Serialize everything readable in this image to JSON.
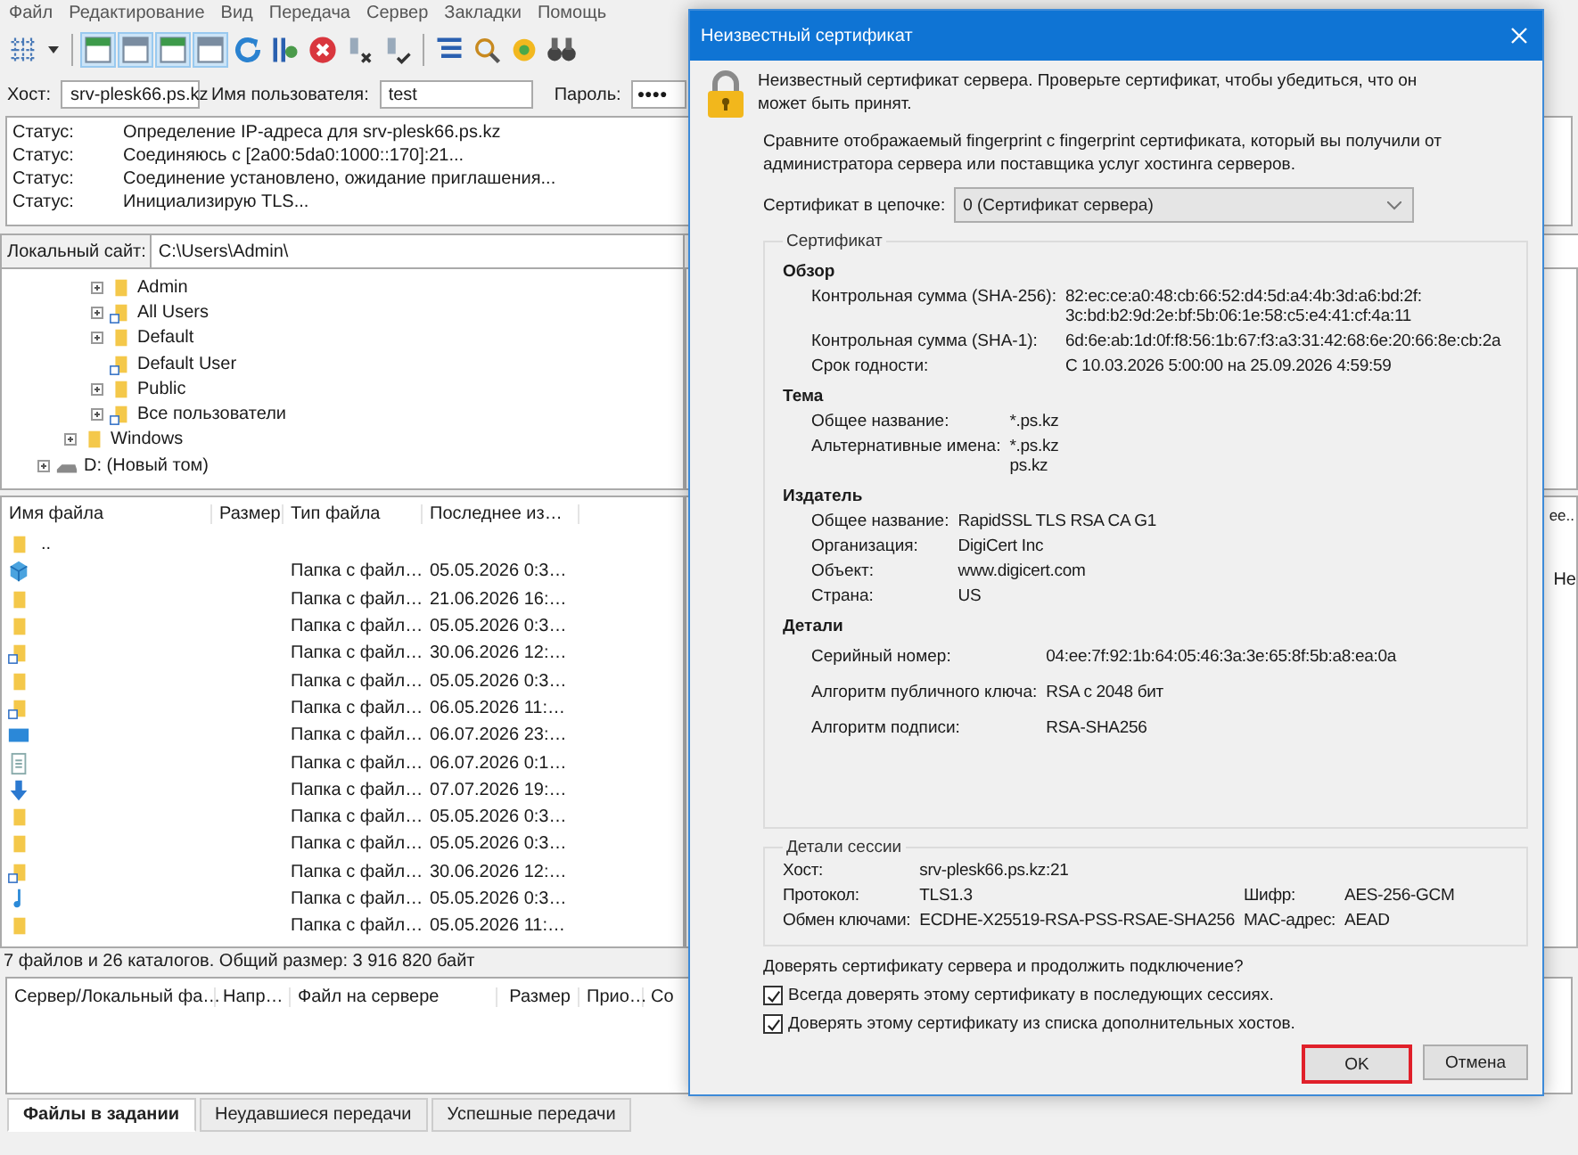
{
  "menu": [
    "Файл",
    "Редактирование",
    "Вид",
    "Передача",
    "Сервер",
    "Закладки",
    "Помощь"
  ],
  "toolbar": {
    "toggles": [
      {
        "pressed": true
      },
      {
        "pressed": true
      },
      {
        "pressed": true
      },
      {
        "pressed": true
      }
    ]
  },
  "quickconnect": {
    "host_label": "Хост:",
    "host": "srv-plesk66.ps.kz",
    "user_label": "Имя пользователя:",
    "user": "test",
    "password_label": "Пароль:",
    "password": "●●●●"
  },
  "log": [
    {
      "label": "Статус:",
      "message": "Определение IP-адреса для srv-plesk66.ps.kz"
    },
    {
      "label": "Статус:",
      "message": "Соединяюсь с [2a00:5da0:1000::170]:21..."
    },
    {
      "label": "Статус:",
      "message": "Соединение установлено, ожидание приглашения..."
    },
    {
      "label": "Статус:",
      "message": "Инициализирую TLS..."
    }
  ],
  "local_site": {
    "label": "Локальный сайт:",
    "path": "C:\\Users\\Admin\\"
  },
  "tree": [
    {
      "children": [
        {
          "children": [
            {
              "label": "Admin",
              "expandable": true
            },
            {
              "label": "All Users",
              "expandable": true
            },
            {
              "label": "Default",
              "expandable": true
            },
            {
              "label": "Default User",
              "expandable": false
            },
            {
              "label": "Public",
              "expandable": true
            },
            {
              "label": "Все пользователи",
              "expandable": true
            }
          ]
        },
        {
          "label": "Windows",
          "expandable": true
        }
      ]
    },
    {
      "label": "D: (Новый том)",
      "expandable": true
    }
  ],
  "file_list": {
    "columns": [
      "Имя файла",
      "Размер",
      "Тип файла",
      "Последнее из…"
    ],
    "rows": [
      {
        "name": ".."
      },
      {
        "type": "Папка с файл…",
        "modified": "05.05.2026 0:3…"
      },
      {
        "type": "Папка с файл…",
        "modified": "21.06.2026 16:…"
      },
      {
        "type": "Папка с файл…",
        "modified": "05.05.2026 0:3…"
      },
      {
        "type": "Папка с файл…",
        "modified": "30.06.2026 12:…"
      },
      {
        "type": "Папка с файл…",
        "modified": "05.05.2026 0:3…"
      },
      {
        "type": "Папка с файл…",
        "modified": "06.05.2026 11:…"
      },
      {
        "type": "Папка с файл…",
        "modified": "06.07.2026 23:…"
      },
      {
        "type": "Папка с файл…",
        "modified": "06.07.2026 0:1…"
      },
      {
        "type": "Папка с файл…",
        "modified": "07.07.2026 19:…"
      },
      {
        "type": "Папка с файл…",
        "modified": "05.05.2026 0:3…"
      },
      {
        "type": "Папка с файл…",
        "modified": "05.05.2026 0:3…"
      },
      {
        "type": "Папка с файл…",
        "modified": "30.06.2026 12:…"
      },
      {
        "type": "Папка с файл…",
        "modified": "05.05.2026 0:3…"
      },
      {
        "type": "Папка с файл…",
        "modified": "05.05.2026 11:…"
      }
    ]
  },
  "file_summary": "7 файлов и 26 каталогов. Общий размер: 3 916 820 байт",
  "remote_pane": {
    "column_header": "ее..",
    "message": "Не"
  },
  "queue": {
    "columns": [
      "Сервер/Локальный фа…",
      "Напр…",
      "Файл на сервере",
      "Размер",
      "Прио…",
      "Со"
    ]
  },
  "queue_tabs": [
    {
      "label": "Файлы в задании",
      "selected": true
    },
    {
      "label": "Неудавшиеся передачи",
      "selected": false
    },
    {
      "label": "Успешные передачи",
      "selected": false
    }
  ],
  "dialog": {
    "title": "Неизвестный сертификат",
    "intro": "Неизвестный сертификат сервера. Проверьте сертификат, чтобы убедиться, что он может быть принят.",
    "compare": "Сравните отображаемый fingerprint с fingerprint сертификата, который вы получили от администратора сервера или поставщика услуг хостинга серверов.",
    "chain_label": "Сертификат в цепочке:",
    "chain_value": "0 (Сертификат сервера)",
    "certificate_title": "Сертификат",
    "sections": [
      {
        "title": "Обзор",
        "rows": [
          {
            "label": "Контрольная сумма (SHA-256):",
            "values": [
              "82:ec:ce:a0:48:cb:66:52:d4:5d:a4:4b:3d:a6:bd:2f:",
              "3c:bd:b2:9d:2e:bf:5b:06:1e:58:c5:e4:41:cf:4a:11"
            ]
          },
          {
            "label": "Контрольная сумма (SHA-1):",
            "values": [
              "6d:6e:ab:1d:0f:f8:56:1b:67:f3:a3:31:42:68:6e:20:66:8e:cb:2a"
            ]
          },
          {
            "label": "Срок годности:",
            "values": [
              "С 10.03.2026 5:00:00 на 25.09.2026 4:59:59"
            ]
          }
        ]
      },
      {
        "title": "Тема",
        "rows": [
          {
            "label": "Общее название:",
            "values": [
              "*.ps.kz"
            ]
          },
          {
            "label": "Альтернативные имена:",
            "values": [
              "*.ps.kz",
              "ps.kz"
            ]
          }
        ]
      },
      {
        "title": "Издатель",
        "rows": [
          {
            "label": "Общее название:",
            "values": [
              "RapidSSL TLS RSA CA G1"
            ]
          },
          {
            "label": "Организация:",
            "values": [
              "DigiCert Inc"
            ]
          },
          {
            "label": "Объект:",
            "values": [
              "www.digicert.com"
            ]
          },
          {
            "label": "Страна:",
            "values": [
              "US"
            ]
          }
        ]
      },
      {
        "title": "Детали",
        "rows": [
          {
            "label": "Серийный номер:",
            "values": [
              "04:ee:7f:92:1b:64:05:46:3a:3e:65:8f:5b:a8:ea:0a"
            ]
          },
          {
            "label": "Алгоритм публичного ключа:",
            "values": [
              "RSA с 2048 бит"
            ]
          },
          {
            "label": "Алгоритм подписи:",
            "values": [
              "RSA-SHA256"
            ]
          }
        ]
      }
    ],
    "session_title": "Детали сессии",
    "session": [
      {
        "label": "Хост:",
        "value": "srv-plesk66.ps.kz:21"
      },
      {
        "label": "Протокол:",
        "value": "TLS1.3",
        "label2": "Шифр:",
        "value2": "AES-256-GCM"
      },
      {
        "label": "Обмен ключами:",
        "value": "ECDHE-X25519-RSA-PSS-RSAE-SHA256",
        "label2": "MAC-адрес:",
        "value2": "AEAD"
      }
    ],
    "question": "Доверять сертификату сервера и продолжить подключение?",
    "options": [
      {
        "label": "Всегда доверять этому сертификату в последующих сессиях.",
        "checked": true
      },
      {
        "label": "Доверять этому сертификату из списка дополнительных хостов.",
        "checked": true
      }
    ],
    "buttons": [
      {
        "label": "OK",
        "highlighted": true
      },
      {
        "label": "Отмена",
        "highlighted": false
      }
    ]
  }
}
